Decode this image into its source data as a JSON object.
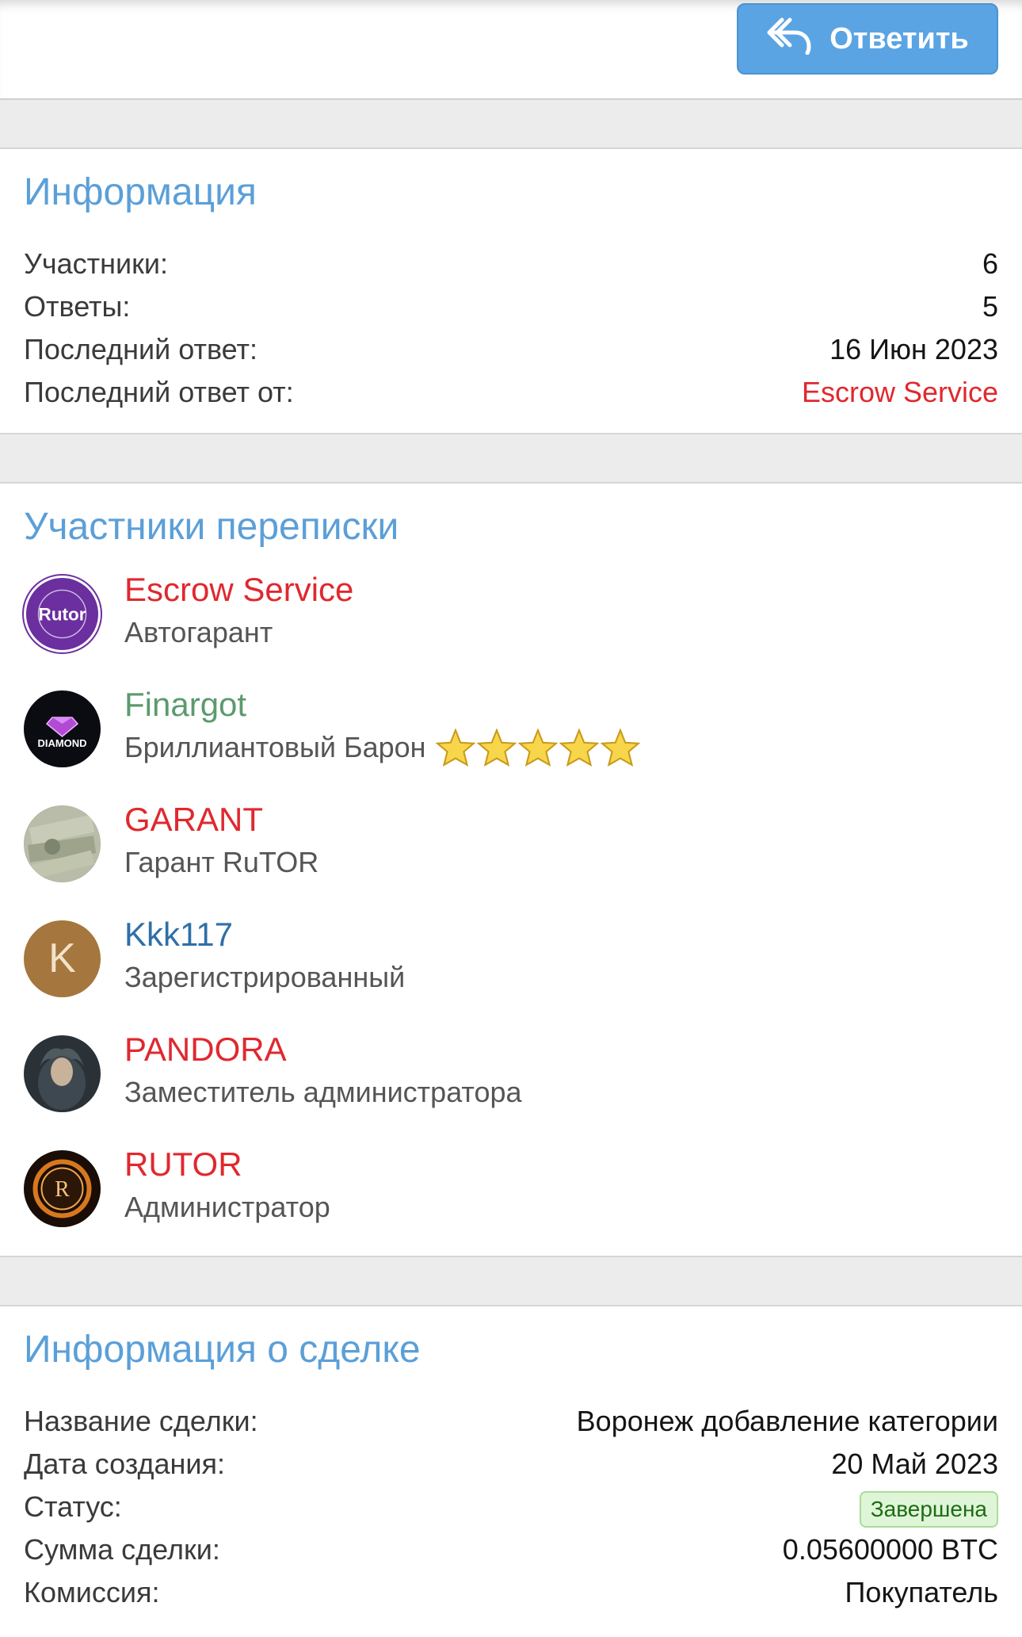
{
  "toolbar": {
    "reply_label": "Ответить"
  },
  "info": {
    "title": "Информация",
    "rows": [
      {
        "label": "Участники:",
        "value": "6"
      },
      {
        "label": "Ответы:",
        "value": "5"
      },
      {
        "label": "Последний ответ:",
        "value": "16 Июн 2023"
      },
      {
        "label": "Последний ответ от:",
        "value": "Escrow Service"
      }
    ]
  },
  "participants": {
    "title": "Участники переписки",
    "members": [
      {
        "name": "Escrow Service",
        "role": "Автогарант",
        "name_color": "#e0282e",
        "avatar": "rutor-escrow-logo",
        "avatar_text": "Rutor"
      },
      {
        "name": "Finargot",
        "role": "Бриллиантовый Барон",
        "name_color": "#5c9a6e",
        "avatar": "diamond-logo",
        "avatar_text": "DIAMOND",
        "stars": 5
      },
      {
        "name": "GARANT",
        "role": "Гарант RuTOR",
        "name_color": "#e0282e",
        "avatar": "money-photo"
      },
      {
        "name": "Kkk117",
        "role": "Зарегистрированный",
        "name_color": "#2f6fa8",
        "avatar": "letter-avatar",
        "avatar_text": "K"
      },
      {
        "name": "PANDORA",
        "role": "Заместитель администратора",
        "name_color": "#e0282e",
        "avatar": "portrait-photo"
      },
      {
        "name": "RUTOR",
        "role": "Администратор",
        "name_color": "#e0282e",
        "avatar": "rutor-emblem",
        "avatar_text": "R"
      }
    ]
  },
  "deal": {
    "title": "Информация о сделке",
    "rows": [
      {
        "label": "Название сделки:",
        "value": "Воронеж добавление категории"
      },
      {
        "label": "Дата создания:",
        "value": "20 Май 2023"
      },
      {
        "label": "Статус:",
        "value": "Завершена"
      },
      {
        "label": "Сумма сделки:",
        "value": "0.05600000 BTC"
      },
      {
        "label": "Комиссия:",
        "value": "Покупатель"
      }
    ]
  },
  "colors": {
    "accent": "#5aa4e3",
    "title": "#5b9fd8",
    "red": "#e0282e",
    "green_name": "#5c9a6e",
    "blue_name": "#2f6fa8"
  }
}
